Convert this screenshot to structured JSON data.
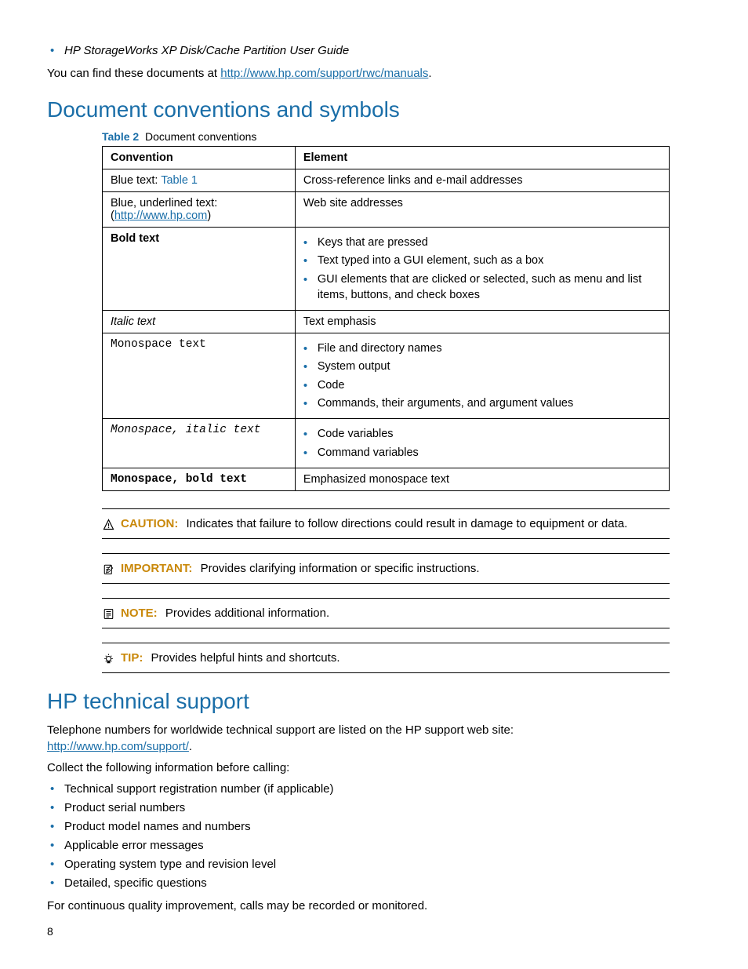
{
  "top_bullet": "HP StorageWorks XP Disk/Cache Partition User Guide",
  "find_docs_prefix": "You can find these documents at ",
  "find_docs_link": "http://www.hp.com/support/rwc/manuals",
  "find_docs_suffix": ".",
  "h1_conventions": "Document conventions and symbols",
  "table2_label": "Table 2",
  "table2_title": "Document conventions",
  "table2": {
    "headers": [
      "Convention",
      "Element"
    ],
    "rows": {
      "r0": {
        "conv_prefix": "Blue text: ",
        "conv_link": "Table 1",
        "elem": "Cross-reference links and e-mail addresses"
      },
      "r1": {
        "conv_prefix": "Blue, underlined text: (",
        "conv_link": "http://www.hp.com",
        "conv_suffix": ")",
        "elem": "Web site addresses"
      },
      "r2": {
        "conv": "Bold text",
        "elem_items": [
          "Keys that are pressed",
          "Text typed into a GUI element, such as a box",
          "GUI elements that are clicked or selected, such as menu and list items, buttons, and check boxes"
        ]
      },
      "r3": {
        "conv": "Italic text",
        "elem": "Text emphasis"
      },
      "r4": {
        "conv": "Monospace text",
        "elem_items": [
          "File and directory names",
          "System output",
          "Code",
          "Commands, their arguments, and argument values"
        ]
      },
      "r5": {
        "conv": "Monospace, italic text",
        "elem_items": [
          "Code variables",
          "Command variables"
        ]
      },
      "r6": {
        "conv": "Monospace, bold text",
        "elem": "Emphasized monospace text"
      }
    }
  },
  "admon": {
    "caution": {
      "label": "CAUTION:",
      "text": "Indicates that failure to follow directions could result in damage to equipment or data."
    },
    "important": {
      "label": "IMPORTANT:",
      "text": "Provides clarifying information or specific instructions."
    },
    "note": {
      "label": "NOTE:",
      "text": "Provides additional information."
    },
    "tip": {
      "label": "TIP:",
      "text": "Provides helpful hints and shortcuts."
    }
  },
  "h1_support": "HP technical support",
  "support_intro_prefix": "Telephone numbers for worldwide technical support are listed on the HP support web site: ",
  "support_intro_link": "http://www.hp.com/support/",
  "support_intro_suffix": ".",
  "collect_intro": "Collect the following information before calling:",
  "collect_items": [
    "Technical support registration number (if applicable)",
    "Product serial numbers",
    "Product model names and numbers",
    "Applicable error messages",
    "Operating system type and revision level",
    "Detailed, specific questions"
  ],
  "recorded": "For continuous quality improvement, calls may be recorded or monitored.",
  "page_number": "8"
}
